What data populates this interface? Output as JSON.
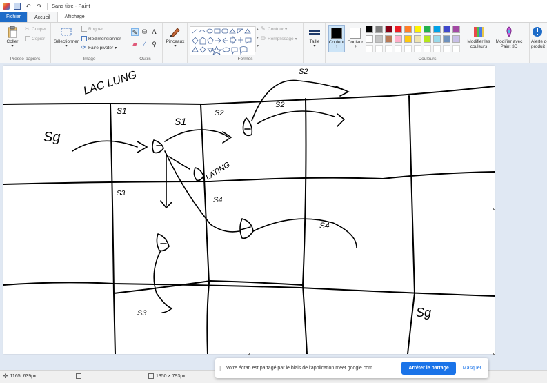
{
  "window": {
    "title": "Sans titre - Paint",
    "undo_glyph": "↶",
    "redo_glyph": "↷"
  },
  "tabs": {
    "file": "Fichier",
    "home": "Accueil",
    "view": "Affichage"
  },
  "ribbon": {
    "clipboard": {
      "label": "Presse-papiers",
      "paste": "Coller",
      "cut": "Couper",
      "copy": "Copier"
    },
    "image": {
      "label": "Image",
      "select": "Sélectionner",
      "crop": "Rogner",
      "resize": "Redimensionner",
      "rotate": "Faire pivoter"
    },
    "tools": {
      "label": "Outils"
    },
    "brushes": {
      "label": "Pinceaux"
    },
    "shapes": {
      "label": "Formes",
      "outline": "Contour",
      "fill": "Remplissage"
    },
    "size": {
      "label": "Taille"
    },
    "colors": {
      "label": "Couleurs",
      "color1": "Couleur 1",
      "color2": "Couleur 2",
      "edit": "Modifier les couleurs",
      "paint3d": "Modifier avec Paint 3D",
      "alert": "Alerte de produit",
      "color1_value": "#000000",
      "color2_value": "#ffffff",
      "palette_row1": [
        "#000000",
        "#7f7f7f",
        "#880015",
        "#ed1c24",
        "#ff7f27",
        "#fff200",
        "#22b14c",
        "#00a2e8",
        "#3f48cc",
        "#a349a4"
      ],
      "palette_row2": [
        "#ffffff",
        "#c3c3c3",
        "#b97a57",
        "#ffaec9",
        "#ffc90e",
        "#efe4b0",
        "#b5e61d",
        "#99d9ea",
        "#7092be",
        "#c8bfe7"
      ],
      "palette_row3": [
        "#ffffff",
        "#ffffff",
        "#ffffff",
        "#ffffff",
        "#ffffff",
        "#ffffff",
        "#ffffff",
        "#ffffff",
        "#ffffff",
        "#ffffff"
      ]
    }
  },
  "canvas": {
    "drawing_labels": [
      "LAC LUNG",
      "S1",
      "S1",
      "S2",
      "S2",
      "S2",
      "Sg",
      "S3",
      "S4",
      "S4",
      "S3",
      "Sg",
      "LATING"
    ]
  },
  "status": {
    "cursor_position": "1165, 639px",
    "image_size": "1350 × 793px"
  },
  "share_banner": {
    "message": "Votre écran est partagé par le biais de l'application meet.google.com.",
    "stop_button": "Arrêter le partage",
    "hide_button": "Masquer",
    "grip": "‖"
  }
}
